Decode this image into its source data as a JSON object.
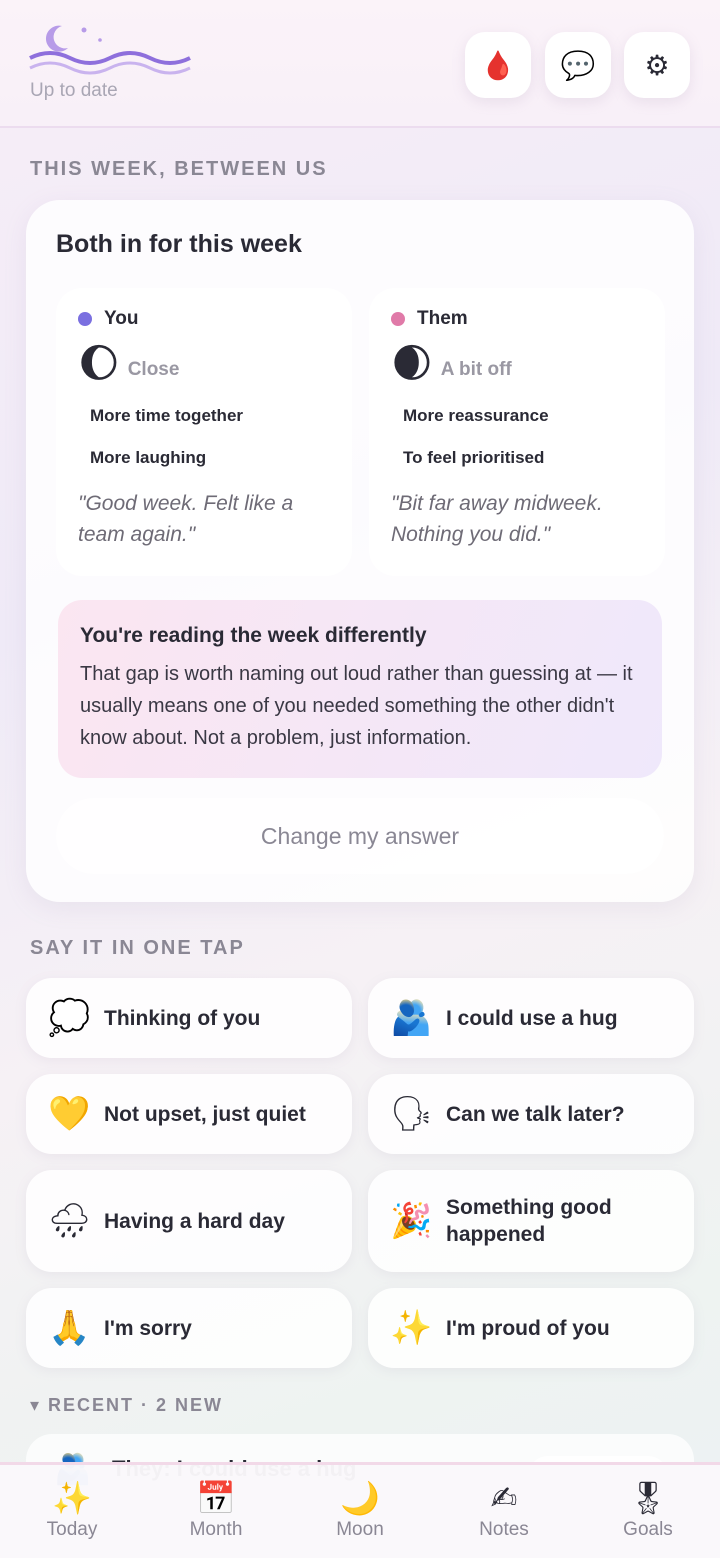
{
  "header": {
    "status": "Up to date",
    "buttons": [
      {
        "name": "period-drop-icon",
        "glyph": "🩸"
      },
      {
        "name": "chat-bubble-icon",
        "glyph": "💬"
      },
      {
        "name": "gear-icon",
        "glyph": "⚙"
      }
    ]
  },
  "week": {
    "section_label": "THIS WEEK, BETWEEN US",
    "title": "Both in for this week",
    "you": {
      "label": "You",
      "dot_color": "#7a6fe0",
      "moon": "🌔",
      "mood": "Close",
      "needs": [
        "More time together",
        "More laughing"
      ],
      "quote": "\"Good week. Felt like a team again.\""
    },
    "them": {
      "label": "Them",
      "dot_color": "#e07aa8",
      "moon": "🌒",
      "mood": "A bit off",
      "needs": [
        "More reassurance",
        "To feel prioritised"
      ],
      "quote": "\"Bit far away midweek. Nothing you did.\""
    },
    "insight": {
      "title": "You're reading the week differently",
      "body": "That gap is worth naming out loud rather than guessing at — it usually means one of you needed something the other didn't know about. Not a problem, just information."
    },
    "change_label": "Change my answer"
  },
  "taps": {
    "section_label": "SAY IT IN ONE TAP",
    "items": [
      {
        "icon": "💭",
        "label": "Thinking of you"
      },
      {
        "icon": "🫂",
        "label": "I could use a hug"
      },
      {
        "icon": "💛",
        "label": "Not upset, just quiet"
      },
      {
        "icon": "🗣",
        "label": "Can we talk later?"
      },
      {
        "icon": "🌧",
        "label": "Having a hard day"
      },
      {
        "icon": "🎉",
        "label": "Something good happened"
      },
      {
        "icon": "🙏",
        "label": "I'm sorry"
      },
      {
        "icon": "✨",
        "label": "I'm proud of you"
      }
    ]
  },
  "recent": {
    "label": "▾ RECENT · 2 NEW",
    "first_item": {
      "icon": "🫂",
      "text": "They: I could use a hug"
    }
  },
  "tabs": [
    {
      "icon": "✨",
      "label": "Today"
    },
    {
      "icon": "📅",
      "label": "Month"
    },
    {
      "icon": "🌙",
      "label": "Moon"
    },
    {
      "icon": "✍",
      "label": "Notes"
    },
    {
      "icon": "🎖",
      "label": "Goals"
    }
  ]
}
